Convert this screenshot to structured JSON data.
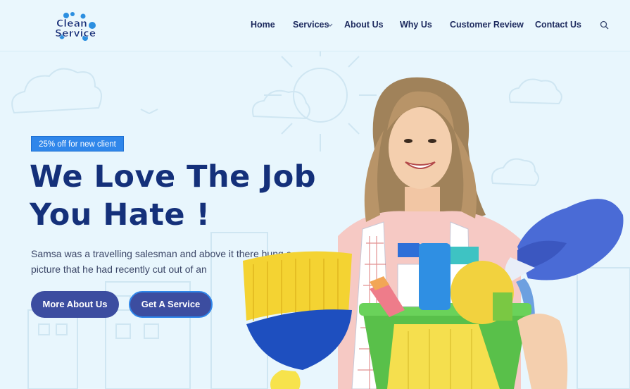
{
  "header": {
    "logo_text": [
      "Clean",
      "Service"
    ],
    "nav": [
      {
        "label": "Home"
      },
      {
        "label": "Services"
      },
      {
        "label": "About Us"
      },
      {
        "label": "Why Us"
      },
      {
        "label": "Customer Review"
      },
      {
        "label": "Contact Us"
      }
    ],
    "search_icon": "search-icon"
  },
  "hero": {
    "badge": "25% off for new client",
    "headline_line1": "We Love The Job",
    "headline_line2": "You Hate !",
    "description": "Samsa was a travelling salesman and above it there hung a picture that he had recently cut out of an",
    "primary_button": "More About Us",
    "secondary_button": "Get A Service"
  },
  "colors": {
    "background": "#e8f6fd",
    "navy": "#14307a",
    "button": "#3c4da0",
    "badge": "#2f86ea"
  }
}
